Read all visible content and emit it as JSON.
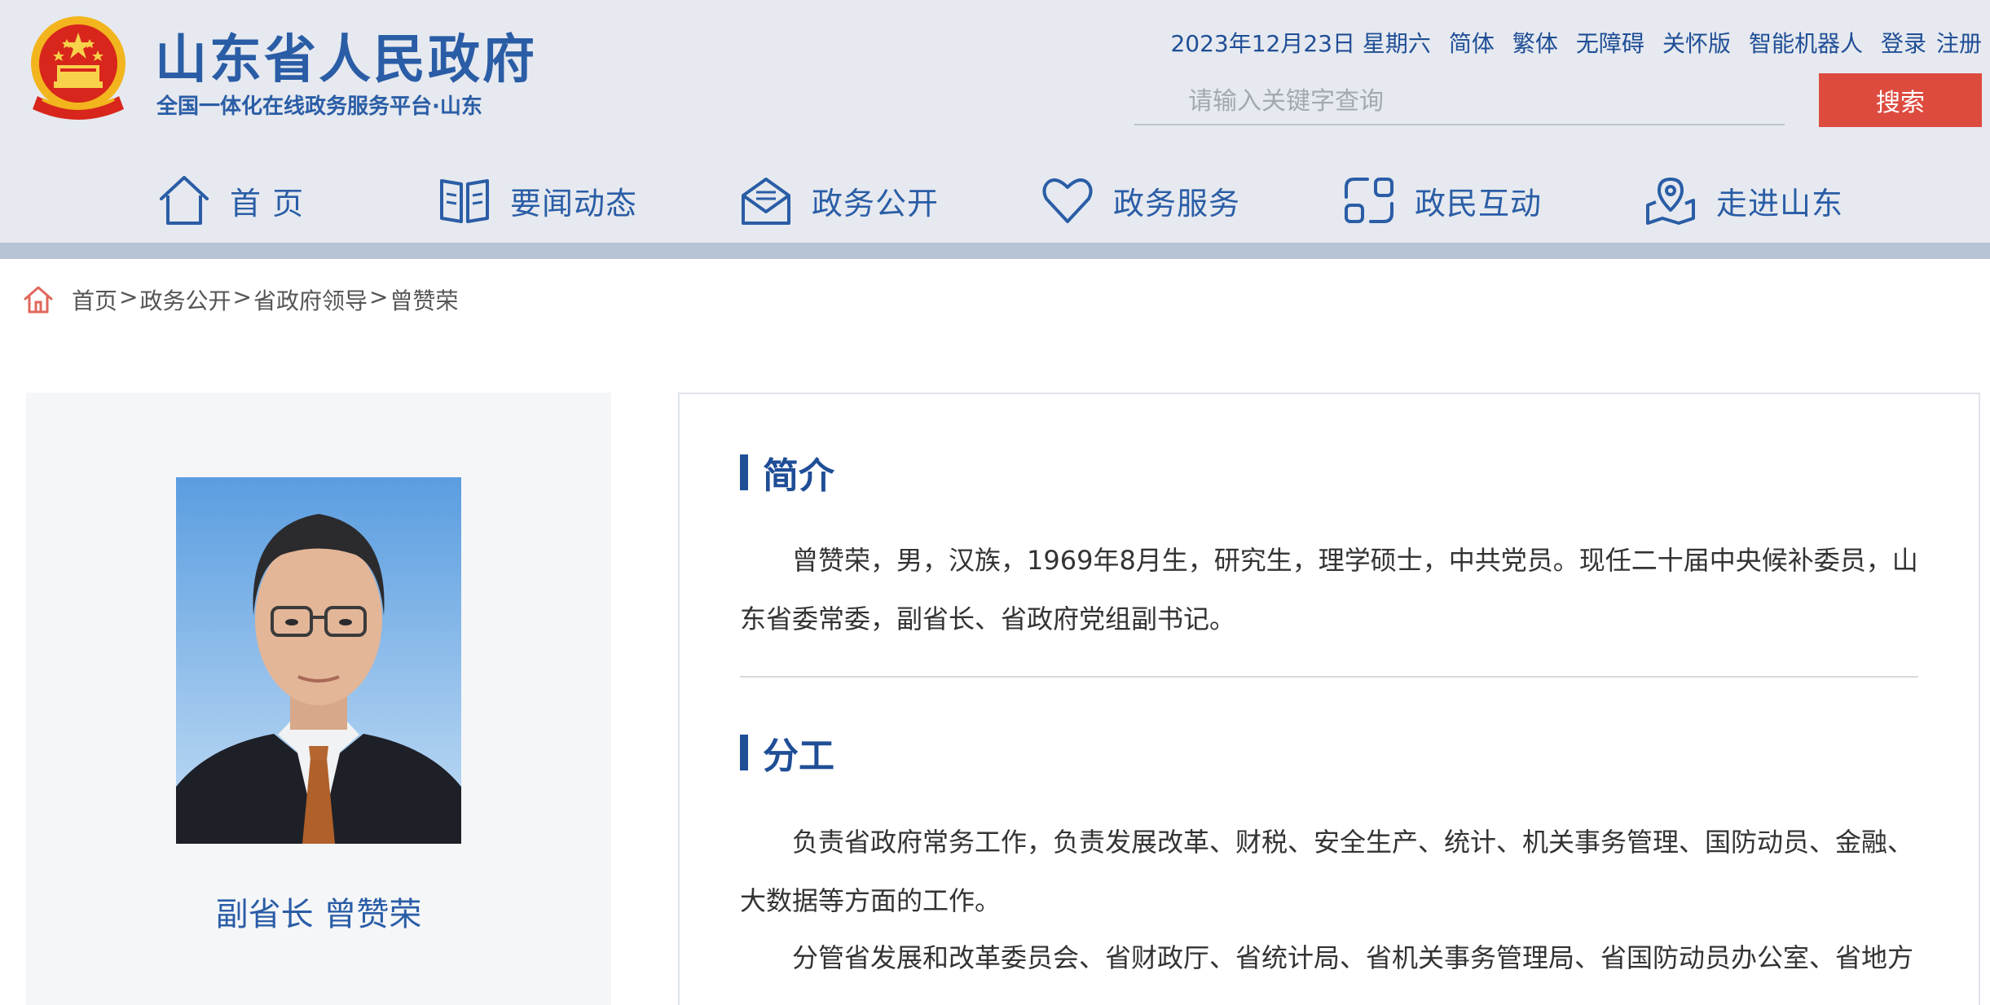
{
  "header": {
    "site_title": "山东省人民政府",
    "site_subtitle": "全国一体化在线政务服务平台·山东",
    "emblem_icon": "national-emblem-icon",
    "date": "2023年12月23日 星期六",
    "links": {
      "simplified": "简体",
      "traditional": "繁体",
      "accessibility": "无障碍",
      "elderly": "关怀版",
      "robot": "智能机器人",
      "login": "登录",
      "register": "注册"
    },
    "search": {
      "placeholder": "请输入关键字查询",
      "button_label": "搜索"
    },
    "nav": {
      "home": "首 页",
      "news": "要闻动态",
      "public": "政务公开",
      "service": "政务服务",
      "interaction": "政民互动",
      "about": "走进山东"
    }
  },
  "breadcrumb": {
    "home_icon": "home-icon",
    "items": [
      "首页",
      "政务公开",
      "省政府领导",
      "曾赞荣"
    ],
    "separator": ">"
  },
  "profile": {
    "name": "副省长 曾赞荣"
  },
  "content": {
    "intro_title": "简介",
    "intro_text": "曾赞荣，男，汉族，1969年8月生，研究生，理学硕士，中共党员。现任二十届中央候补委员，山东省委常委，副省长、省政府党组副书记。",
    "duty_title": "分工",
    "duty_text_1": "负责省政府常务工作，负责发展改革、财税、安全生产、统计、机关事务管理、国防动员、金融、大数据等方面的工作。",
    "duty_text_2": "分管省发展和改革委员会、省财政厅、省统计局、省机关事务管理局、省国防动员办公室、省地方"
  },
  "colors": {
    "brand_blue": "#2a5da6",
    "header_bg": "#e6e9ef",
    "search_red": "#dd4b3f",
    "home_icon_red": "#e0675a"
  }
}
